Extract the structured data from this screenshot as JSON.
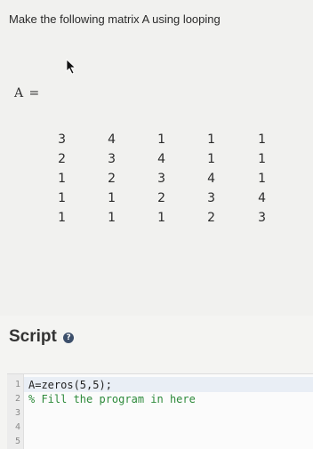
{
  "instruction": "Make the following matrix A using looping",
  "matrix": {
    "label": "A =",
    "rows": [
      [
        "3",
        "4",
        "1",
        "1",
        "1"
      ],
      [
        "2",
        "3",
        "4",
        "1",
        "1"
      ],
      [
        "1",
        "2",
        "3",
        "4",
        "1"
      ],
      [
        "1",
        "1",
        "2",
        "3",
        "4"
      ],
      [
        "1",
        "1",
        "1",
        "2",
        "3"
      ]
    ]
  },
  "script": {
    "title": "Script",
    "help_icon": "help-icon",
    "lines": [
      {
        "num": "1",
        "text": "A=zeros(5,5);"
      },
      {
        "num": "2",
        "text": "% Fill the program in here"
      },
      {
        "num": "3",
        "text": ""
      },
      {
        "num": "4",
        "text": ""
      },
      {
        "num": "5",
        "text": ""
      }
    ]
  },
  "colors": {
    "comment": "#2d8a3a",
    "help_icon_bg": "#3c4f6b"
  }
}
